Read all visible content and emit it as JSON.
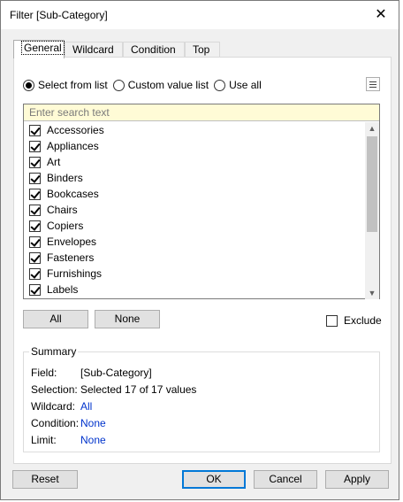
{
  "window": {
    "title": "Filter [Sub-Category]"
  },
  "tabs": [
    "General",
    "Wildcard",
    "Condition",
    "Top"
  ],
  "radios": [
    {
      "label": "Select from list",
      "checked": true
    },
    {
      "label": "Custom value list",
      "checked": false
    },
    {
      "label": "Use all",
      "checked": false
    }
  ],
  "search": {
    "placeholder": "Enter search text",
    "value": ""
  },
  "items": [
    {
      "label": "Accessories",
      "checked": true
    },
    {
      "label": "Appliances",
      "checked": true
    },
    {
      "label": "Art",
      "checked": true
    },
    {
      "label": "Binders",
      "checked": true
    },
    {
      "label": "Bookcases",
      "checked": true
    },
    {
      "label": "Chairs",
      "checked": true
    },
    {
      "label": "Copiers",
      "checked": true
    },
    {
      "label": "Envelopes",
      "checked": true
    },
    {
      "label": "Fasteners",
      "checked": true
    },
    {
      "label": "Furnishings",
      "checked": true
    },
    {
      "label": "Labels",
      "checked": true
    }
  ],
  "buttons": {
    "all": "All",
    "none": "None",
    "exclude": "Exclude",
    "reset": "Reset",
    "ok": "OK",
    "cancel": "Cancel",
    "apply": "Apply"
  },
  "exclude_checked": false,
  "summary": {
    "title": "Summary",
    "rows": [
      {
        "label": "Field:",
        "value": "[Sub-Category]",
        "link": false
      },
      {
        "label": "Selection:",
        "value": "Selected 17 of 17 values",
        "link": false
      },
      {
        "label": "Wildcard:",
        "value": "All",
        "link": true
      },
      {
        "label": "Condition:",
        "value": "None",
        "link": true
      },
      {
        "label": "Limit:",
        "value": "None",
        "link": true
      }
    ]
  },
  "colors": {
    "accent": "#0078d7",
    "link": "#0033cc",
    "search_bg": "#fffbd6"
  },
  "icons": {
    "close": "close-icon",
    "menu": "list-menu-icon"
  }
}
